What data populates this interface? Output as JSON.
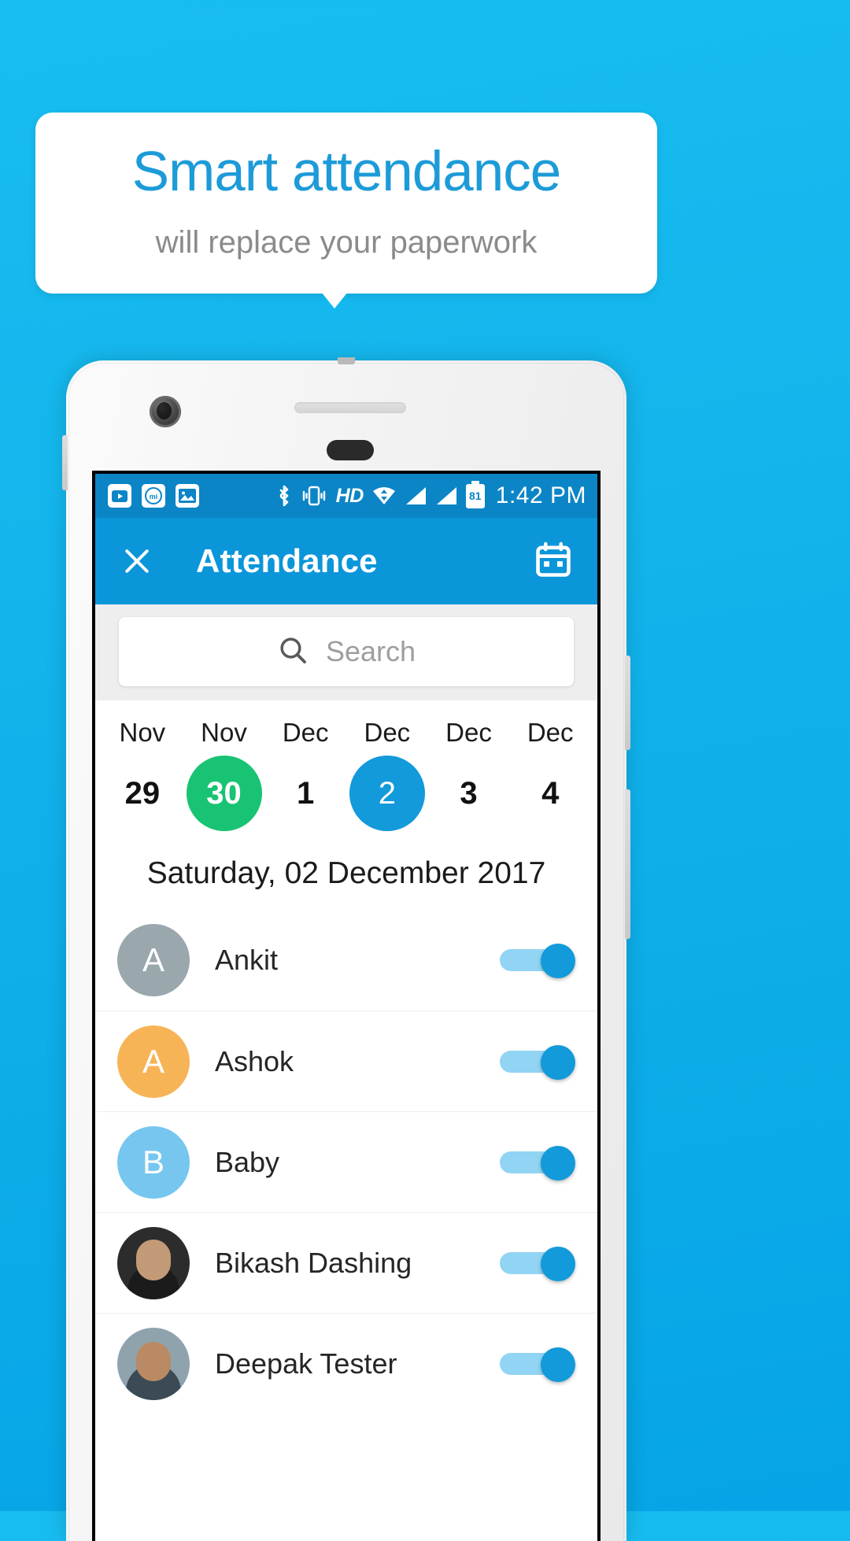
{
  "promo": {
    "title": "Smart attendance",
    "subtitle": "will replace your paperwork",
    "title_color": "#1d9bd8",
    "subtitle_color": "#8b8b8b",
    "background_color": "#13b5ec"
  },
  "statusbar": {
    "time": "1:42 PM",
    "battery_level": "81",
    "hd_label": "HD",
    "left_icons": [
      "youtube-icon",
      "mi-music-icon",
      "gallery-icon"
    ],
    "right_icons": [
      "bluetooth-icon",
      "vibrate-icon",
      "hd-icon",
      "wifi-icon",
      "signal-icon-1",
      "signal-icon-2",
      "battery-icon"
    ],
    "background_color": "#0b85c6"
  },
  "appbar": {
    "title": "Attendance",
    "close_icon": "close-icon",
    "calendar_icon": "calendar-icon",
    "background_color": "#0b96d9"
  },
  "search": {
    "placeholder": "Search",
    "value": "",
    "icon": "search-icon"
  },
  "dates": [
    {
      "month": "Nov",
      "day": "29",
      "state": "normal"
    },
    {
      "month": "Nov",
      "day": "30",
      "state": "today"
    },
    {
      "month": "Dec",
      "day": "1",
      "state": "normal"
    },
    {
      "month": "Dec",
      "day": "2",
      "state": "selected"
    },
    {
      "month": "Dec",
      "day": "3",
      "state": "normal"
    },
    {
      "month": "Dec",
      "day": "4",
      "state": "normal"
    }
  ],
  "date_heading": "Saturday, 02 December 2017",
  "colors": {
    "today": "#18c473",
    "selected": "#129ada",
    "toggle_on": "#129ada",
    "toggle_track": "#92d4f3"
  },
  "attendees": [
    {
      "name": "Ankit",
      "initial": "A",
      "avatar_type": "initial",
      "avatar_color": "#9aa7ad",
      "toggle": "on"
    },
    {
      "name": "Ashok",
      "initial": "A",
      "avatar_type": "initial",
      "avatar_color": "#f7b457",
      "toggle": "on"
    },
    {
      "name": "Baby",
      "initial": "B",
      "avatar_type": "initial",
      "avatar_color": "#76c6ef",
      "toggle": "on"
    },
    {
      "name": "Bikash Dashing",
      "initial": "",
      "avatar_type": "photo-dark",
      "avatar_color": "#2c2c2c",
      "toggle": "on"
    },
    {
      "name": "Deepak Tester",
      "initial": "",
      "avatar_type": "photo-light",
      "avatar_color": "#8fa3ad",
      "toggle": "on"
    }
  ]
}
